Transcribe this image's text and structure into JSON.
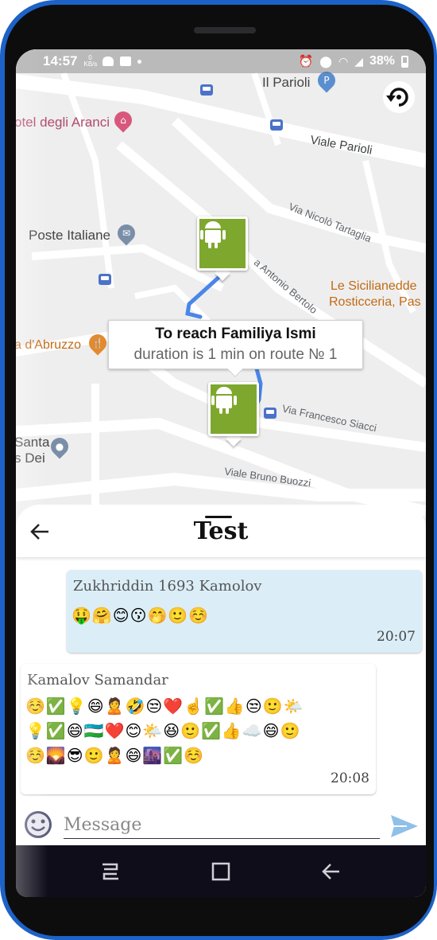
{
  "status_bar": {
    "time": "14:57",
    "net_speed_value": "0",
    "net_speed_unit": "KB/s",
    "battery": "38%"
  },
  "map": {
    "labels": {
      "il_parioli": "Il Parioli",
      "hotel": "otel degli Aranci",
      "viale_parioli": "Viale Parioli",
      "via_tartaglia": "Via Nicolò Tartaglia",
      "poste": "Poste Italiane",
      "via_bertolo": "a Antonio Bertolo",
      "siciliane_1": "Le Sicilianedde",
      "siciliane_2": "Rosticceria, Pas",
      "abruzzo": "a d'Abruzzo",
      "via_siacci": "Via Francesco Siacci",
      "santa_1": "Santa",
      "santa_2": "s Dei",
      "viale_buozzi": "Viale Bruno Buozzi"
    },
    "route_info": {
      "title": "To reach Familiya Ismi",
      "subtitle": "duration is 1 min on route № 1"
    },
    "route_color": "#4a86e8",
    "marker_color": "#7ea72e"
  },
  "chat": {
    "title": "Test",
    "messages": [
      {
        "sender": "Zukhriddin 1693 Kamolov",
        "emojis": [
          "🤑🤗😊😗🤭🙂☺️"
        ],
        "time": "20:07"
      },
      {
        "sender": "Kamalov Samandar",
        "emojis": [
          "☺️✅💡😄🙎🤣😒❤️☝️✅👍😒🙂🌤️",
          "💡✅😄🇺🇿❤️😊🌤️😆🙂✅👍☁️😄🙂",
          "☺️🌄😎🙂🙎😄🌆✅☺️"
        ],
        "time": "20:08"
      }
    ],
    "input_placeholder": "Message"
  }
}
